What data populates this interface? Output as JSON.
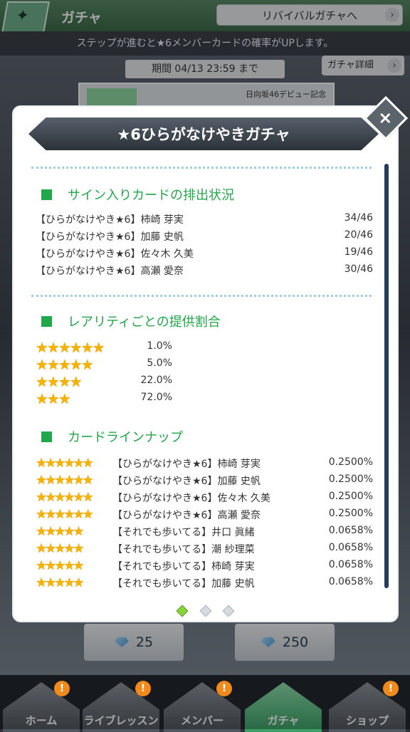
{
  "app": {
    "title": "ガチャ",
    "revival_button": "リバイバルガチャへ",
    "banner_text": "ステップが進むと★6メンバーカードの確率がUPします。",
    "period": "期間 04/13 23:59 まで",
    "detail_button": "ガチャ詳細",
    "banner_caption": "日向坂46デビュー記念",
    "pull_costs": [
      "25",
      "250"
    ]
  },
  "modal": {
    "title": "★6ひらがなけやきガチャ",
    "section_signed": {
      "heading": "サイン入りカードの排出状況",
      "rows": [
        {
          "name": "【ひらがなけやき★6】柿崎 芽実",
          "value": "34/46"
        },
        {
          "name": "【ひらがなけやき★6】加藤 史帆",
          "value": "20/46"
        },
        {
          "name": "【ひらがなけやき★6】佐々木 久美",
          "value": "19/46"
        },
        {
          "name": "【ひらがなけやき★6】高瀬 愛奈",
          "value": "30/46"
        }
      ]
    },
    "section_rarity": {
      "heading": "レアリティごとの提供割合",
      "rows": [
        {
          "stars": 6,
          "pct": "1.0%"
        },
        {
          "stars": 5,
          "pct": "5.0%"
        },
        {
          "stars": 4,
          "pct": "22.0%"
        },
        {
          "stars": 3,
          "pct": "72.0%"
        }
      ]
    },
    "section_lineup": {
      "heading": "カードラインナップ",
      "rows": [
        {
          "stars": 6,
          "name": "【ひらがなけやき★6】柿崎 芽実",
          "pct": "0.2500%"
        },
        {
          "stars": 6,
          "name": "【ひらがなけやき★6】加藤 史帆",
          "pct": "0.2500%"
        },
        {
          "stars": 6,
          "name": "【ひらがなけやき★6】佐々木 久美",
          "pct": "0.2500%"
        },
        {
          "stars": 6,
          "name": "【ひらがなけやき★6】高瀬 愛奈",
          "pct": "0.2500%"
        },
        {
          "stars": 5,
          "name": "【それでも歩いてる】井口 眞緒",
          "pct": "0.0658%"
        },
        {
          "stars": 5,
          "name": "【それでも歩いてる】潮 紗理菜",
          "pct": "0.0658%"
        },
        {
          "stars": 5,
          "name": "【それでも歩いてる】柿崎 芽実",
          "pct": "0.0658%"
        },
        {
          "stars": 5,
          "name": "【それでも歩いてる】加藤 史帆",
          "pct": "0.0658%"
        }
      ]
    },
    "pager": {
      "pages": 3,
      "current": 1
    }
  },
  "nav": {
    "items": [
      {
        "label": "ホーム",
        "badge": "!"
      },
      {
        "label": "ライブレッスン",
        "badge": "!"
      },
      {
        "label": "メンバー",
        "badge": "!"
      },
      {
        "label": "ガチャ",
        "badge": ""
      },
      {
        "label": "ショップ",
        "badge": "!"
      }
    ],
    "active": "ガチャ"
  },
  "colors": {
    "accent": "#21a84a",
    "star": "#f3b300",
    "badge": "#f08a1c"
  }
}
